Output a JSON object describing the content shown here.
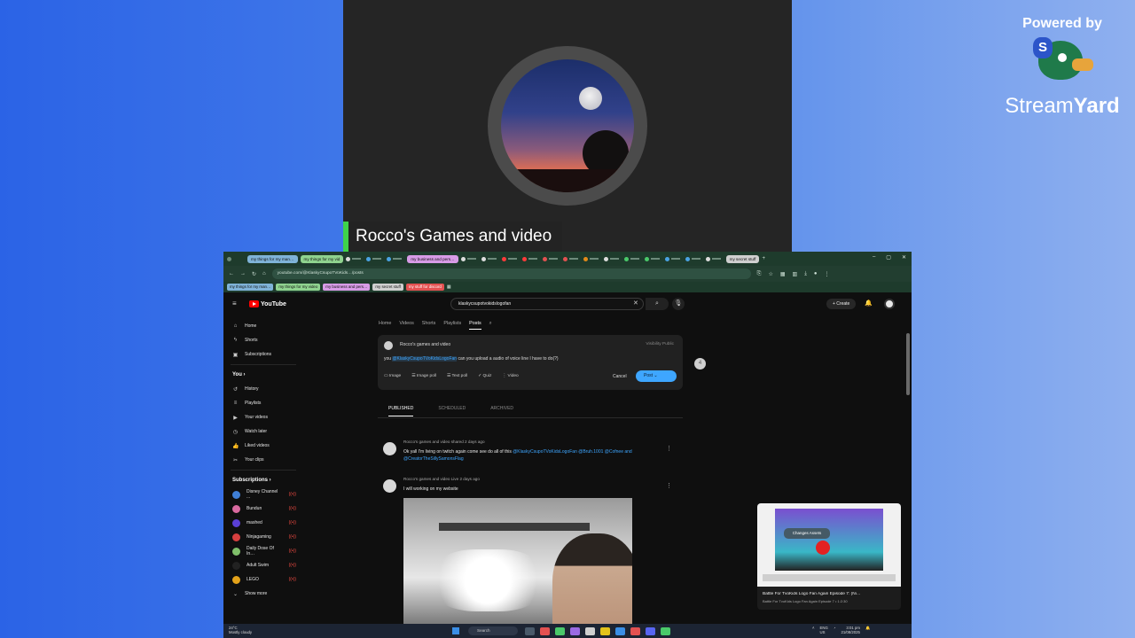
{
  "stream": {
    "presenter_name": "Rocco's Games and video",
    "powered_by": "Powered by",
    "brand_part1": "Stream",
    "brand_part2": "Yard",
    "brand_badge": "S"
  },
  "browser": {
    "tabs": [
      "my things for my man…",
      "my things for my vid",
      "my business and pers…",
      "my secret stuff"
    ],
    "url": "youtube.com/@KlaskyCsupoTVoKids…/posts",
    "bookmarks": [
      "my things for my man…",
      "my things for my video",
      "my business and pers…",
      "my secret stuff",
      "my stuff for discord"
    ]
  },
  "youtube": {
    "logo": "YouTube",
    "search_value": "klaskycsupotvokidslogofan",
    "create_label": "+ Create",
    "sidebar_main": [
      {
        "label": "Home",
        "icon": "home-icon",
        "glyph": "⌂"
      },
      {
        "label": "Shorts",
        "icon": "shorts-icon",
        "glyph": "ϟ"
      },
      {
        "label": "Subscriptions",
        "icon": "subscriptions-icon",
        "glyph": "▣"
      }
    ],
    "you_heading": "You ›",
    "sidebar_you": [
      {
        "label": "History",
        "icon": "history-icon",
        "glyph": "↺"
      },
      {
        "label": "Playlists",
        "icon": "playlists-icon",
        "glyph": "≡"
      },
      {
        "label": "Your videos",
        "icon": "your-videos-icon",
        "glyph": "▶"
      },
      {
        "label": "Watch later",
        "icon": "watch-later-icon",
        "glyph": "◷"
      },
      {
        "label": "Liked videos",
        "icon": "liked-videos-icon",
        "glyph": "👍"
      },
      {
        "label": "Your clips",
        "icon": "clips-icon",
        "glyph": "✂"
      }
    ],
    "subscriptions_heading": "Subscriptions ›",
    "subscriptions": [
      {
        "label": "Disney Channel ...",
        "color": "#3f7fd6"
      },
      {
        "label": "Bundun",
        "color": "#d96aa0"
      },
      {
        "label": "mashed",
        "color": "#5a3fd6"
      },
      {
        "label": "Ninjagaming",
        "color": "#d63f3f"
      },
      {
        "label": "Daily Dose Of In…",
        "color": "#7fbf6a"
      },
      {
        "label": "Adult Swim",
        "color": "#222222"
      },
      {
        "label": "LEGO",
        "color": "#e3a21a"
      }
    ],
    "show_more": "Show more",
    "channel_tabs": [
      "Home",
      "Videos",
      "Shorts",
      "Playlists",
      "Posts"
    ],
    "composer": {
      "channel_name": "Rocco's games and video",
      "visibility": "Visibility   Public",
      "text_before": "you ",
      "mention": "@KlaskyCsupoTVoKidsLogoFan",
      "text_after": "  can you upload a audio of voice line I have to do(?)",
      "tools": [
        "Image",
        "Image poll",
        "Text poll",
        "Quiz",
        "Video"
      ],
      "cancel": "Cancel",
      "post": "Post"
    },
    "post_tabs": [
      "PUBLISHED",
      "SCHEDULED",
      "ARCHIVED"
    ],
    "posts": [
      {
        "meta": "Rocco's games and video  shared 2 days ago",
        "text": "Ok yall I'm living on twitch again come see do all of this ",
        "tags": "@KlaskyCsupoTVoKidsLogoFan @Bruh.1001 @Cofnee and @CreatorTheSillySamonsFlag"
      },
      {
        "meta": "Rocco's games and video Live  2 days ago",
        "text": "I will working on my website"
      }
    ],
    "mini_player": {
      "sign_text": "Changes Assets",
      "title": "Battle For TvoKids Logo Fan Again Episode 7: (Ni…",
      "subtitle": "Battle For TvoKids Logo Fan Again Episode 7 • 1:2:30"
    }
  },
  "taskbar": {
    "weather_temp": "24°C",
    "weather_desc": "Mostly cloudy",
    "search": "Search",
    "lang": "ENG\nUS",
    "time": "3:01 pm",
    "date": "21/08/2025"
  }
}
